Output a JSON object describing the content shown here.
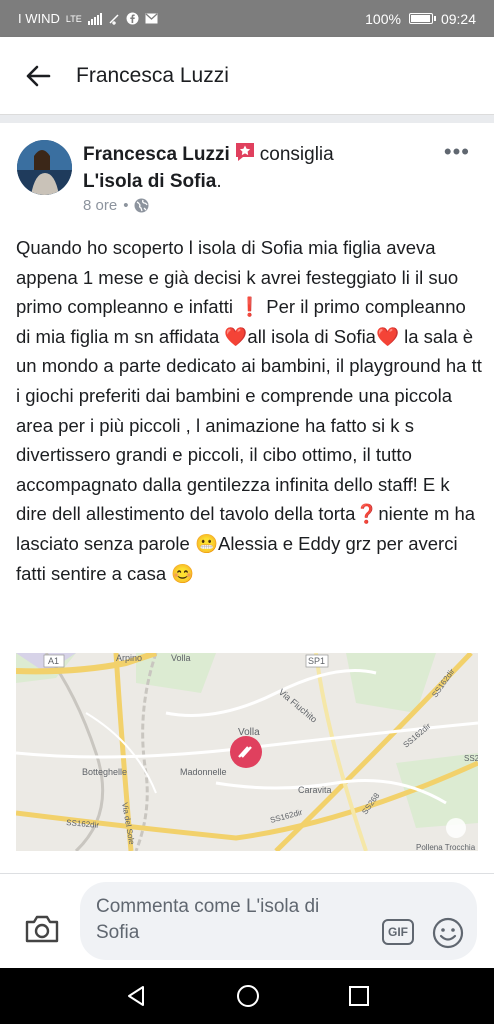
{
  "status": {
    "carrier": "I WIND",
    "network": "LTE",
    "battery_pct": "100%",
    "battery_level": 1.0,
    "time": "09:24"
  },
  "appbar": {
    "title": "Francesca Luzzi"
  },
  "post": {
    "author": "Francesca Luzzi",
    "action": "consiglia",
    "page": "L'isola di Sofia",
    "page_suffix": ".",
    "time": "8 ore",
    "separator": "•",
    "body": "Quando ho scoperto l isola di Sofia mia figlia aveva appena 1 mese e già decisi k avrei festeggiato li il suo primo compleanno e infatti ❗ Per il primo compleanno di mia figlia m sn affidata ❤️all isola di Sofia❤️ la sala è un mondo a parte dedicato ai bambini, il playground ha tt i giochi preferiti dai bambini e comprende una piccola area per i più piccoli , l animazione ha fatto si k s divertissero grandi e piccoli, il cibo ottimo, il tutto accompagnato dalla gentilezza infinita dello staff! E k dire dell allestimento del tavolo della torta❓niente m ha lasciato senza parole 😬Alessia e Eddy grz per averci fatti sentire a casa 😊",
    "more_label": "•••"
  },
  "map": {
    "labels": {
      "a1": "A1",
      "arpino": "Arpino",
      "volla_top": "Volla",
      "sp1": "SP1",
      "via_fiuchito": "Via Fiuchito",
      "volla": "Volla",
      "botteghelle": "Botteghelle",
      "madonnelle": "Madonnelle",
      "caravita": "Caravita",
      "ss162dir_left": "SS162dir",
      "ss162dir_mid": "SS162dir",
      "ss162dir_right": "SS162dir",
      "ss162dir_topright": "SS162dir",
      "ss268": "SS268",
      "via_del_sole": "Via del Sole",
      "ss2": "SS2",
      "pollena": "Pollena Trocchia"
    }
  },
  "composer": {
    "placeholder": "Commenta come L'isola di Sofia",
    "gif_label": "GIF"
  },
  "colors": {
    "status_bg": "#7d7d7d",
    "text": "#1c1e21",
    "meta": "#8d949e",
    "pin": "#e0405e",
    "star": "#e0405e"
  }
}
